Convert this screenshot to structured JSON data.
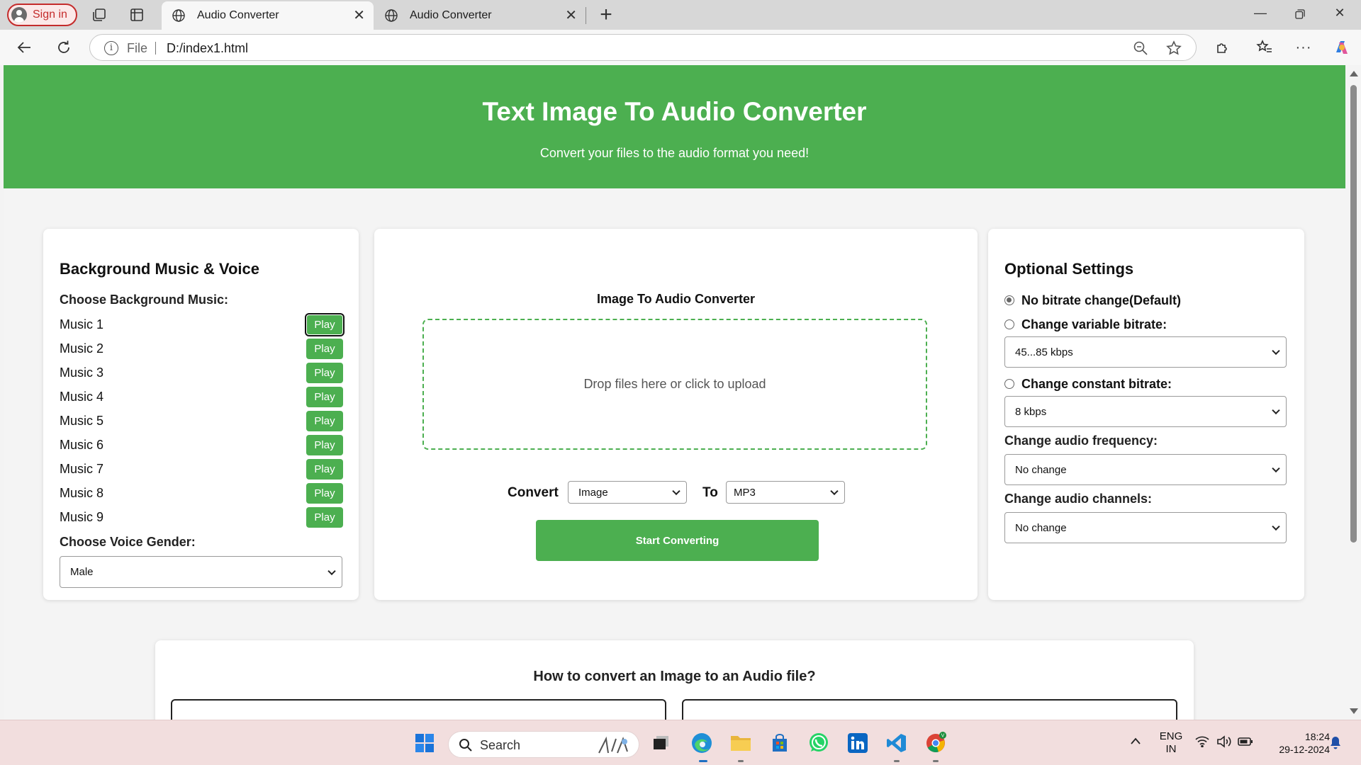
{
  "browser": {
    "signin_label": "Sign in",
    "tabs": [
      {
        "title": "Audio Converter",
        "active": true
      },
      {
        "title": "Audio Converter",
        "active": false
      }
    ],
    "address": {
      "scheme_label": "File",
      "url": "D:/index1.html"
    }
  },
  "header": {
    "title": "Text Image To Audio Converter",
    "subtitle": "Convert your files to the audio format you need!"
  },
  "left_panel": {
    "heading": "Background Music & Voice",
    "music_label": "Choose Background Music:",
    "tracks": [
      {
        "name": "Music 1",
        "button": "Play"
      },
      {
        "name": "Music 2",
        "button": "Play"
      },
      {
        "name": "Music 3",
        "button": "Play"
      },
      {
        "name": "Music 4",
        "button": "Play"
      },
      {
        "name": "Music 5",
        "button": "Play"
      },
      {
        "name": "Music 6",
        "button": "Play"
      },
      {
        "name": "Music 7",
        "button": "Play"
      },
      {
        "name": "Music 8",
        "button": "Play"
      },
      {
        "name": "Music 9",
        "button": "Play"
      }
    ],
    "voice_label": "Choose Voice Gender:",
    "voice_value": "Male"
  },
  "center_panel": {
    "title": "Image To Audio Converter",
    "dropzone_text": "Drop files here or click to upload",
    "convert_label": "Convert",
    "from_value": "Image",
    "to_label": "To",
    "to_value": "MP3",
    "start_button": "Start Converting"
  },
  "right_panel": {
    "heading": "Optional Settings",
    "radio_default": "No bitrate change(Default)",
    "radio_variable": "Change variable bitrate:",
    "variable_value": "45...85 kbps",
    "radio_constant": "Change constant bitrate:",
    "constant_value": "8 kbps",
    "frequency_label": "Change audio frequency:",
    "frequency_value": "No change",
    "channels_label": "Change audio channels:",
    "channels_value": "No change",
    "selected_radio": "No bitrate change(Default)"
  },
  "howto": {
    "heading": "How to convert an Image to an Audio file?"
  },
  "taskbar": {
    "search_placeholder": "Search",
    "language": "ENG",
    "region": "IN",
    "time": "18:24",
    "date": "29-12-2024"
  },
  "colors": {
    "accent": "#4caf50",
    "background": "#f4f4f4",
    "signin": "#c42b2b"
  }
}
